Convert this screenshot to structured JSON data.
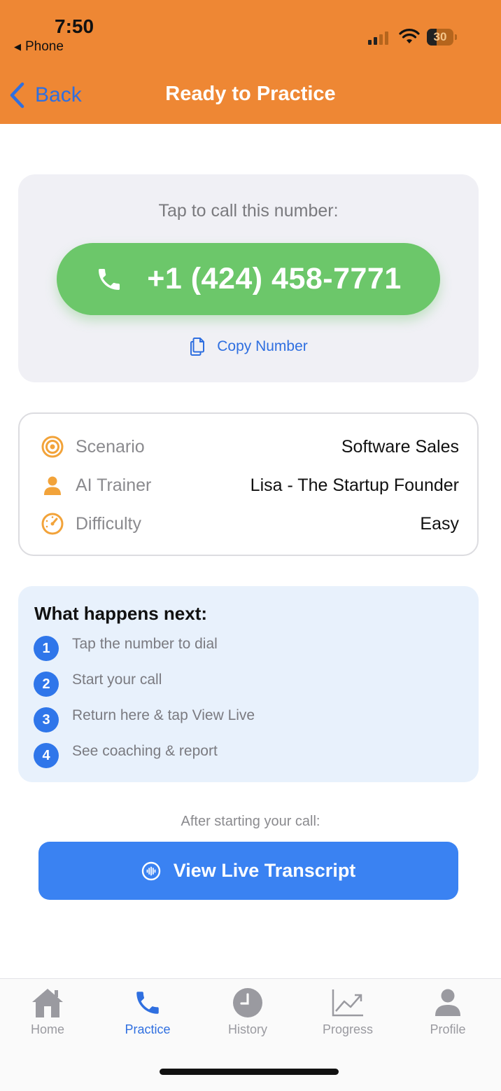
{
  "status_bar": {
    "time": "7:50",
    "back_app": "Phone",
    "battery": "30"
  },
  "nav": {
    "back_label": "Back",
    "title": "Ready to Practice"
  },
  "call_card": {
    "prompt": "Tap to call this number:",
    "phone_number": "+1 (424) 458-7771",
    "copy_label": "Copy Number"
  },
  "details": [
    {
      "icon": "target-icon",
      "label": "Scenario",
      "value": "Software Sales"
    },
    {
      "icon": "person-icon",
      "label": "AI Trainer",
      "value": "Lisa - The Startup Founder"
    },
    {
      "icon": "gauge-icon",
      "label": "Difficulty",
      "value": "Easy"
    }
  ],
  "steps": {
    "title": "What happens next:",
    "items": [
      {
        "num": "1",
        "text": "Tap the number to dial"
      },
      {
        "num": "2",
        "text": "Start your call"
      },
      {
        "num": "3",
        "text": "Return here & tap View Live"
      },
      {
        "num": "4",
        "text": "See coaching & report"
      }
    ]
  },
  "after_call": {
    "label": "After starting your call:",
    "button_label": "View Live Transcript"
  },
  "tabs": [
    {
      "label": "Home",
      "icon": "home-icon",
      "active": false
    },
    {
      "label": "Practice",
      "icon": "phone-icon",
      "active": true
    },
    {
      "label": "History",
      "icon": "clock-icon",
      "active": false
    },
    {
      "label": "Progress",
      "icon": "chart-icon",
      "active": false
    },
    {
      "label": "Profile",
      "icon": "person-icon",
      "active": false
    }
  ],
  "colors": {
    "header": "#EE8734",
    "call_button": "#6CC76A",
    "accent_blue": "#2F76EA",
    "icon_orange": "#F2A33A"
  }
}
